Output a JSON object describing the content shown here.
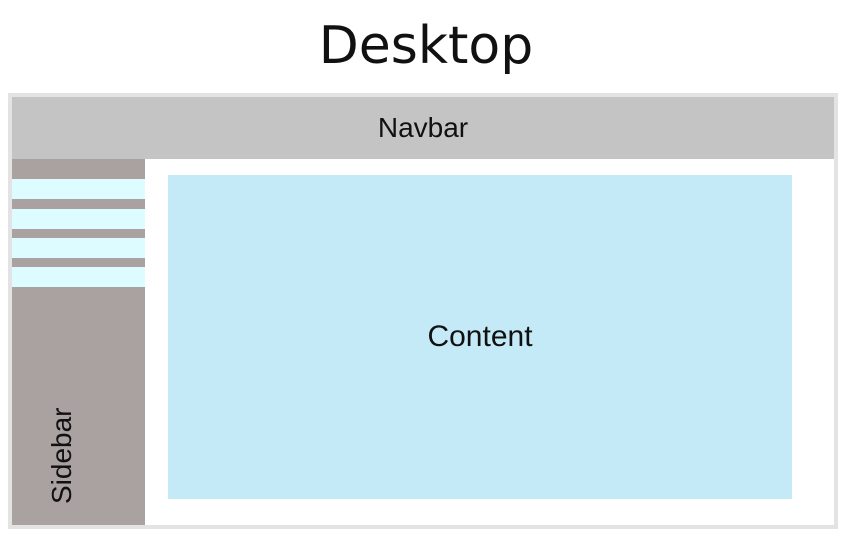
{
  "title": "Desktop",
  "navbar": {
    "label": "Navbar"
  },
  "sidebar": {
    "label": "Sidebar",
    "items": [
      {
        "label": ""
      },
      {
        "label": ""
      },
      {
        "label": ""
      },
      {
        "label": ""
      }
    ]
  },
  "content": {
    "label": "Content"
  },
  "colors": {
    "navbar": "#c4c4c4",
    "sidebar": "#aaa1a1",
    "sidebar_item": "#ddfcff",
    "content": "#c4eaf8",
    "frame_border": "#e3e3e3"
  }
}
